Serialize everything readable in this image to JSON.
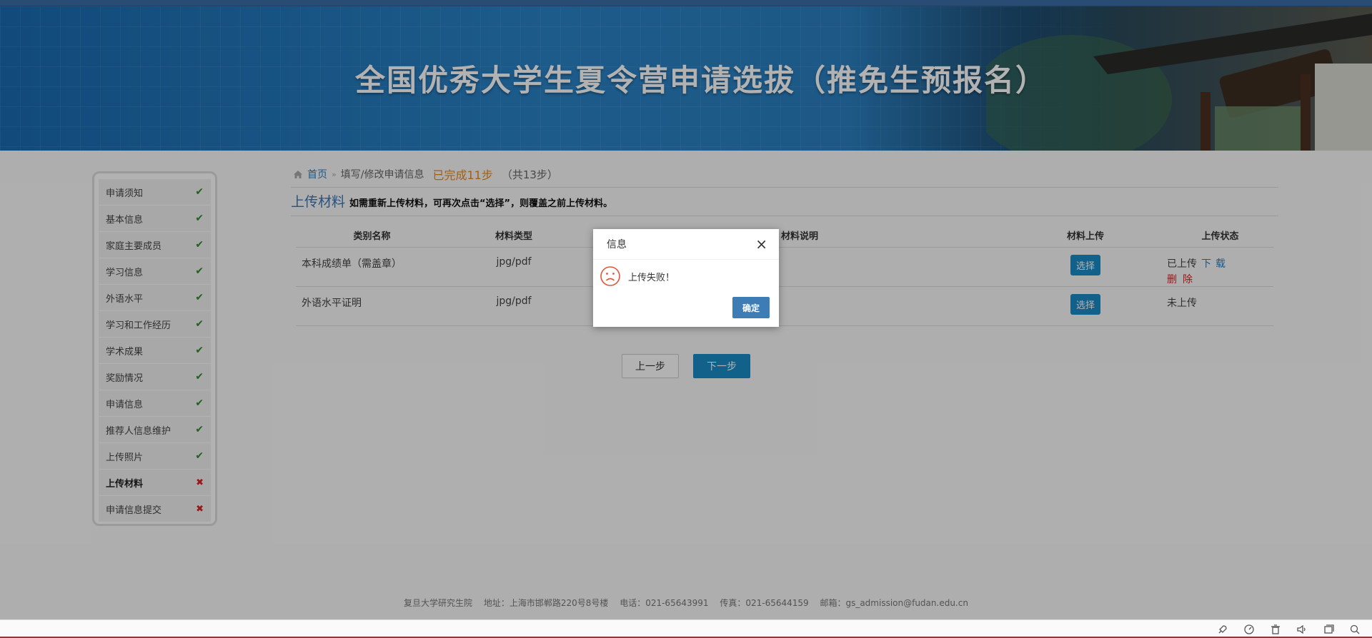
{
  "banner": {
    "title": "全国优秀大学生夏令营申请选拔（推免生预报名）"
  },
  "sidebar": {
    "items": [
      {
        "label": "申请须知",
        "status": "done"
      },
      {
        "label": "基本信息",
        "status": "done"
      },
      {
        "label": "家庭主要成员",
        "status": "done"
      },
      {
        "label": "学习信息",
        "status": "done"
      },
      {
        "label": "外语水平",
        "status": "done"
      },
      {
        "label": "学习和工作经历",
        "status": "done"
      },
      {
        "label": "学术成果",
        "status": "done"
      },
      {
        "label": "奖励情况",
        "status": "done"
      },
      {
        "label": "申请信息",
        "status": "done"
      },
      {
        "label": "推荐人信息维护",
        "status": "done"
      },
      {
        "label": "上传照片",
        "status": "done"
      },
      {
        "label": "上传材料",
        "status": "pending"
      },
      {
        "label": "申请信息提交",
        "status": "pending"
      }
    ],
    "done_mark": "✔",
    "pending_mark": "✖"
  },
  "breadcrumb": {
    "home": "首页",
    "separator": "»",
    "current": "填写/修改申请信息",
    "progress": "已完成11步",
    "total": "（共13步）"
  },
  "section": {
    "title": "上传材料",
    "note": "如需重新上传材料，可再次点击“选择”，则覆盖之前上传材料。"
  },
  "table": {
    "headers": [
      "类别名称",
      "材料类型",
      "材料说明",
      "材料上传",
      "上传状态"
    ],
    "rows": [
      {
        "name": "本科成绩单（需盖章）",
        "type": "jpg/pdf",
        "desc": "",
        "button": "选择",
        "status": "已上传",
        "download": "下载",
        "delete": "删除"
      },
      {
        "name": "外语水平证明",
        "type": "jpg/pdf",
        "desc": "",
        "button": "选择",
        "status": "未上传"
      }
    ]
  },
  "nav": {
    "prev": "上一步",
    "next": "下一步"
  },
  "footer": {
    "text": "复旦大学研究生院　 地址：上海市邯郸路220号8号楼　 电话：021-65643991　 传真：021-65644159　 邮箱：gs_admission@fudan.edu.cn"
  },
  "dialog": {
    "title": "信息",
    "message": "上传失败！",
    "ok": "确定",
    "close": "×"
  },
  "colors": {
    "accent": "#1a8cc6",
    "progress": "#e88a1a",
    "done": "#2e8b2e",
    "pending": "#dd2222"
  }
}
